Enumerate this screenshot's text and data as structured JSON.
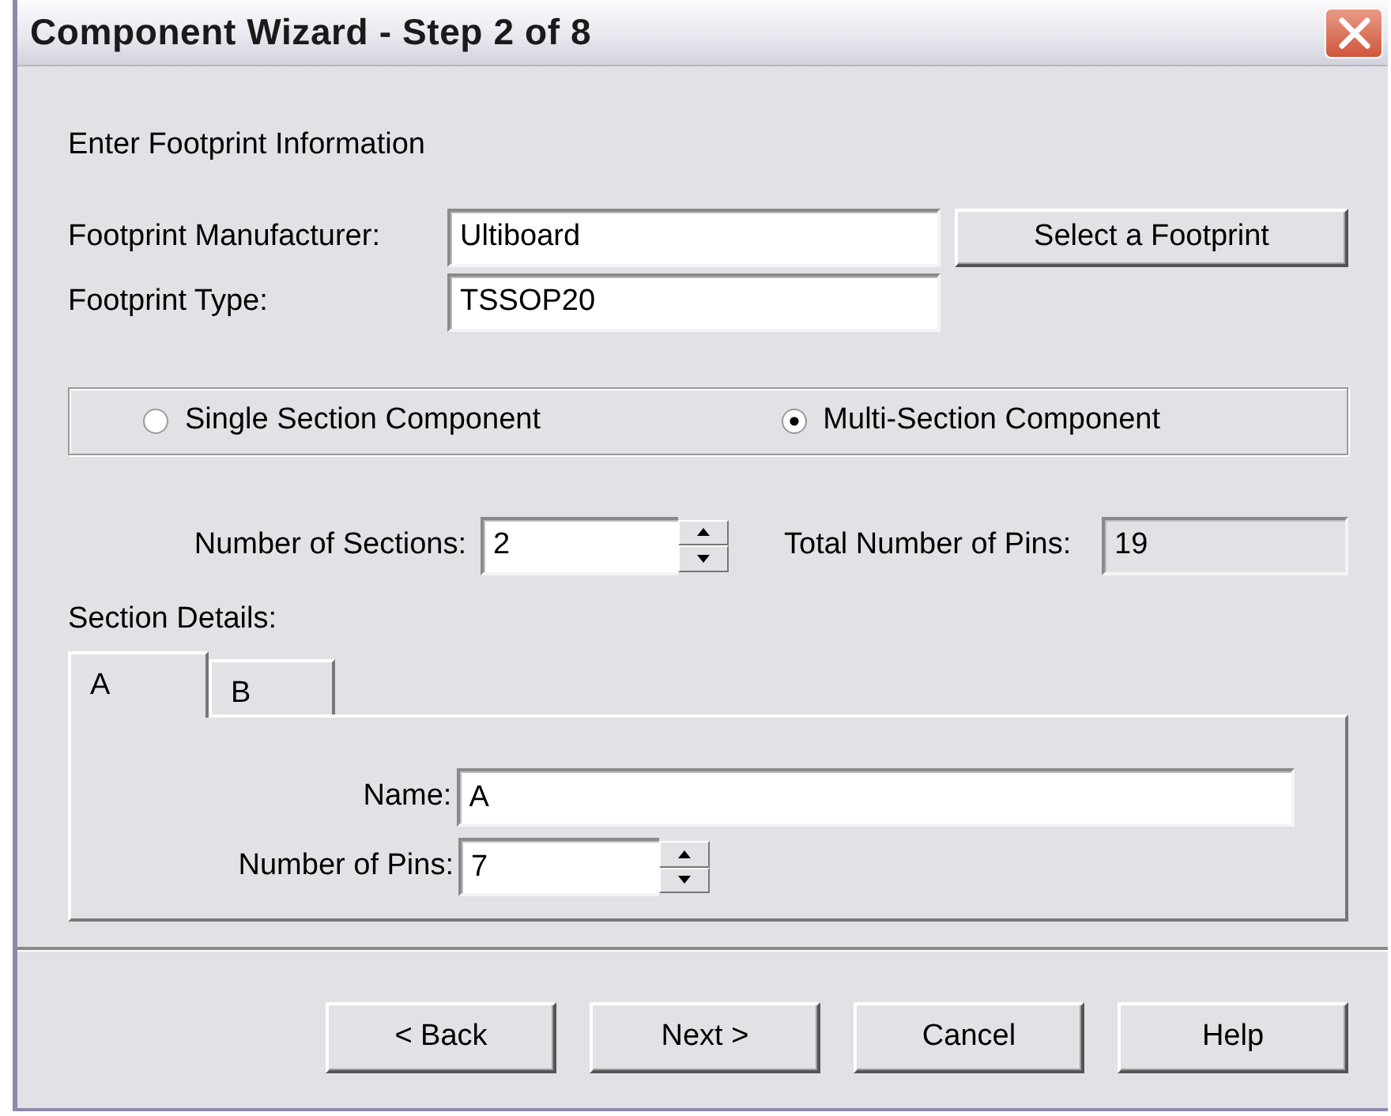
{
  "window": {
    "title": "Component Wizard - Step 2 of 8"
  },
  "heading": "Enter Footprint Information",
  "footprint_fields": [
    {
      "label": "Footprint Manufacturer:",
      "value": "Ultiboard"
    },
    {
      "label": "Footprint Type:",
      "value": "TSSOP20"
    }
  ],
  "select_button": "Select a Footprint",
  "component_types": [
    {
      "label": "Single Section Component",
      "selected": false
    },
    {
      "label": "Multi-Section Component",
      "selected": true
    }
  ],
  "sections_count": {
    "label": "Number of Sections:",
    "value": "2"
  },
  "total_pins": {
    "label": "Total Number of Pins:",
    "value": "19",
    "disabled": true
  },
  "section_details": {
    "label": "Section Details:",
    "tabs": [
      {
        "label": "A",
        "selected": true
      },
      {
        "label": "B",
        "selected": false
      }
    ],
    "name": {
      "label": "Name:",
      "value": "A"
    },
    "pins": {
      "label": "Number of Pins:",
      "value": "7"
    }
  },
  "buttons": [
    "< Back",
    "Next >",
    "Cancel",
    "Help"
  ]
}
